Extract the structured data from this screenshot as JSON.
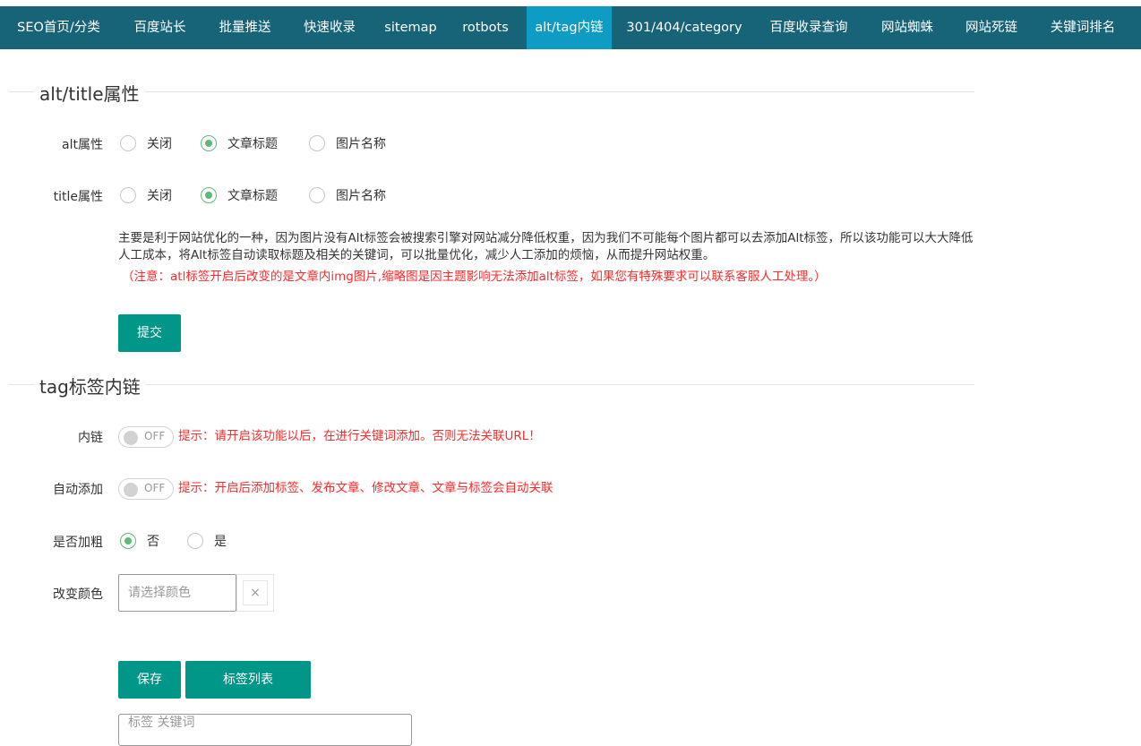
{
  "nav": {
    "items": [
      {
        "label": "SEO首页/分类"
      },
      {
        "label": "百度站长"
      },
      {
        "label": "批量推送"
      },
      {
        "label": "快速收录"
      },
      {
        "label": "sitemap"
      },
      {
        "label": "rotbots"
      },
      {
        "label": "alt/tag内链"
      },
      {
        "label": "301/404/category"
      },
      {
        "label": "百度收录查询"
      },
      {
        "label": "网站蜘蛛"
      },
      {
        "label": "网站死链"
      },
      {
        "label": "关键词排名"
      }
    ],
    "active": "alt/tag内链",
    "background": "#176479",
    "active_background": "#0e9bc4"
  },
  "section_alt": {
    "title": "alt/title属性",
    "alt_row": {
      "label": "alt属性",
      "options": [
        "关闭",
        "文章标题",
        "图片名称"
      ],
      "selected": "文章标题"
    },
    "title_row": {
      "label": "title属性",
      "options": [
        "关闭",
        "文章标题",
        "图片名称"
      ],
      "selected": "文章标题"
    },
    "description": "主要是利于网站优化的一种，因为图片没有Alt标签会被搜索引擎对网站减分降低权重，因为我们不可能每个图片都可以去添加Alt标签，所以该功能可以大大降低人工成本，将Alt标签自动读取标题及相关的关键词，可以批量优化，减少人工添加的烦恼，从而提升网站权重。",
    "note": "（注意：atl标签开启后改变的是文章内img图片,缩略图是因主题影响无法添加alt标签，如果您有特殊要求可以联系客服人工处理。）",
    "submit_label": "提交"
  },
  "section_tag": {
    "title": "tag标签内链",
    "inner_link": {
      "label": "内链",
      "switch_text": "OFF",
      "hint": "提示：请开启该功能以后，在进行关键词添加。否则无法关联URL！"
    },
    "auto_add": {
      "label": "自动添加",
      "switch_text": "OFF",
      "hint": "提示：开启后添加标签、发布文章、修改文章、文章与标签会自动关联"
    },
    "bold": {
      "label": "是否加粗",
      "options": [
        "否",
        "是"
      ],
      "selected": "否"
    },
    "color": {
      "label": "改变颜色",
      "placeholder": "请选择颜色",
      "clear_icon": "×"
    },
    "save_label": "保存",
    "tag_list_label": "标签列表",
    "keyword_placeholder": "标签 关键词"
  },
  "colors": {
    "primary_button": "#009688",
    "radio_checked": "#5fb878",
    "hint_red": "#ff2a2a"
  }
}
